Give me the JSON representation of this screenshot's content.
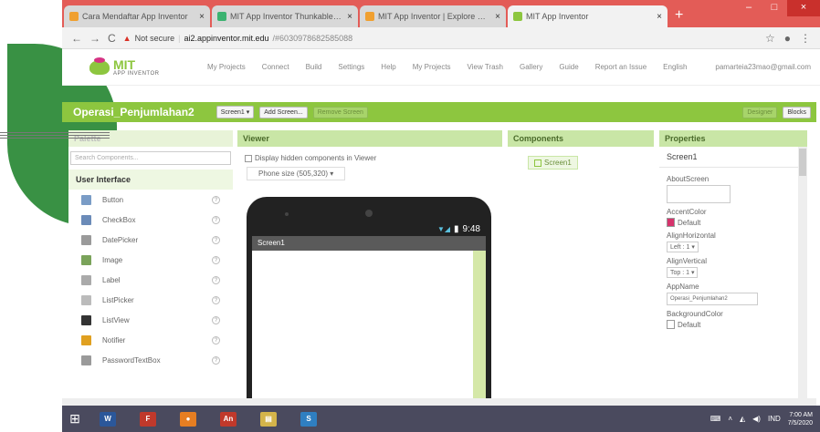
{
  "browser": {
    "tabs": [
      {
        "title": "Cara Mendaftar App Inventor",
        "color": "#f0a030"
      },
      {
        "title": "MIT App Inventor Thunkable koq",
        "color": "#3cb371"
      },
      {
        "title": "MIT App Inventor | Explore MIT App",
        "color": "#f0a030"
      },
      {
        "title": "MIT App Inventor",
        "color": "#8dc63f",
        "active": true
      }
    ],
    "tab_close": "×",
    "new_tab": "+",
    "win_min": "–",
    "win_max": "□",
    "win_close": "×",
    "back": "←",
    "forward": "→",
    "reload": "C",
    "not_secure": "Not secure",
    "url_host": "ai2.appinventor.mit.edu",
    "url_path": "/#6030978682585088",
    "star": "☆"
  },
  "menu": {
    "logo_mit": "MIT",
    "logo_sub": "APP INVENTOR",
    "items": [
      "My Projects",
      "Connect",
      "Build",
      "Settings",
      "Help",
      "My Projects",
      "View Trash",
      "Gallery",
      "Guide",
      "Report an Issue",
      "English"
    ],
    "email": "pamarteia23mao@gmail.com"
  },
  "toolbar": {
    "project_name": "Operasi_Penjumlahan2",
    "screen_select": "Screen1 ▾",
    "add_screen": "Add Screen...",
    "remove_screen": "Remove Screen",
    "designer": "Designer",
    "blocks": "Blocks"
  },
  "palette": {
    "title": "Palette",
    "search_placeholder": "Search Components...",
    "group": "User Interface",
    "items": [
      {
        "label": "Button",
        "color": "#7a9cc6"
      },
      {
        "label": "CheckBox",
        "color": "#6b8bb8"
      },
      {
        "label": "DatePicker",
        "color": "#9a9a9a"
      },
      {
        "label": "Image",
        "color": "#7aa35a"
      },
      {
        "label": "Label",
        "color": "#aaaaaa"
      },
      {
        "label": "ListPicker",
        "color": "#bbbbbb"
      },
      {
        "label": "ListView",
        "color": "#333333"
      },
      {
        "label": "Notifier",
        "color": "#e0a020"
      },
      {
        "label": "PasswordTextBox",
        "color": "#9a9a9a"
      }
    ],
    "help": "?"
  },
  "viewer": {
    "title": "Viewer",
    "display_hidden": "Display hidden components in Viewer",
    "phone_size": "Phone size (505,320) ▾",
    "time": "9:48",
    "screen_title": "Screen1"
  },
  "components": {
    "title": "Components",
    "root": "Screen1"
  },
  "properties": {
    "title": "Properties",
    "screen": "Screen1",
    "about_label": "AboutScreen",
    "accent_label": "AccentColor",
    "accent_value": "Default",
    "accent_color": "#d6336c",
    "align_h_label": "AlignHorizontal",
    "align_h_value": "Left : 1 ▾",
    "align_v_label": "AlignVertical",
    "align_v_value": "Top : 1 ▾",
    "appname_label": "AppName",
    "appname_value": "Operasi_Penjumlahan2",
    "bg_label": "BackgroundColor",
    "bg_value": "Default",
    "bg_color": "#ffffff"
  },
  "taskbar": {
    "start": "⊞",
    "apps": [
      {
        "label": "W",
        "color": "#2b579a"
      },
      {
        "label": "F",
        "color": "#c0392b"
      },
      {
        "label": "●",
        "color": "#e67e22"
      },
      {
        "label": "An",
        "color": "#c0392b"
      },
      {
        "label": "▤",
        "color": "#d4b44a"
      },
      {
        "label": "S",
        "color": "#2f7fc1"
      }
    ],
    "lang": "IND",
    "time": "7:00 AM",
    "date": "7/5/2020"
  }
}
